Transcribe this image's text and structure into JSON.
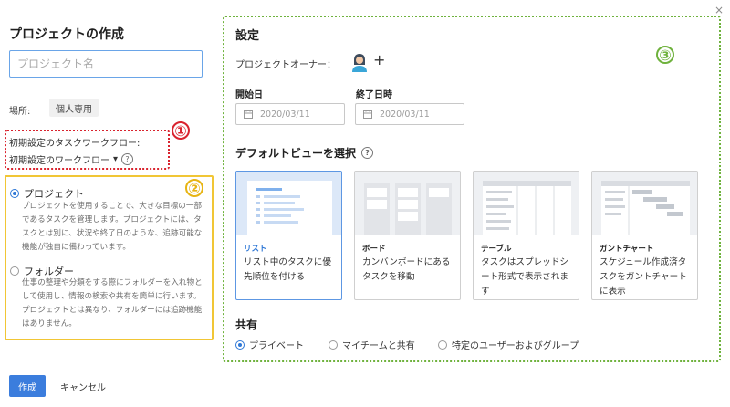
{
  "dialog": {
    "title": "プロジェクトの作成",
    "name_placeholder": "プロジェクト名",
    "location_label": "場所:",
    "location_value": "個人専用",
    "workflow_label": "初期設定のタスクワークフロー:",
    "workflow_select": "初期設定のワークフロー",
    "workflow_caret": "▾",
    "help_glyph": "?",
    "types": [
      {
        "title": "プロジェクト",
        "checked": true,
        "desc": "プロジェクトを使用することで、大きな目標の一部であるタスクを管理します。プロジェクトには、タスクとは別に、状況や終了日のような、追跡可能な機能が独自に備わっています。"
      },
      {
        "title": "フォルダー",
        "checked": false,
        "desc": "仕事の整理や分類をする際にフォルダーを入れ物として使用し、情報の検索や共有を簡単に行います。プロジェクトとは異なり、フォルダーには追跡機能はありません。"
      }
    ],
    "create_label": "作成",
    "cancel_label": "キャンセル",
    "close_glyph": "×"
  },
  "annotations": [
    "①",
    "②",
    "③"
  ],
  "settings": {
    "title": "設定",
    "owner_label": "プロジェクトオーナー：",
    "add_owner_glyph": "+",
    "start_label": "開始日",
    "end_label": "終了日時",
    "start_placeholder": "2020/03/11",
    "end_placeholder": "2020/03/11",
    "default_view_title": "デフォルトビューを選択",
    "views": [
      {
        "title": "リスト",
        "desc": "リスト中のタスクに優先順位を付ける",
        "selected": true
      },
      {
        "title": "ボード",
        "desc": "カンバンボードにあるタスクを移動",
        "selected": false
      },
      {
        "title": "テーブル",
        "desc": "タスクはスプレッドシート形式で表示されます",
        "selected": false
      },
      {
        "title": "ガントチャート",
        "desc": "スケジュール作成済タスクをガントチャートに表示",
        "selected": false
      }
    ],
    "share_title": "共有",
    "share_options": [
      {
        "label": "プライベート",
        "checked": true
      },
      {
        "label": "マイチームと共有",
        "checked": false
      },
      {
        "label": "特定のユーザーおよびグループ",
        "checked": false
      }
    ]
  },
  "colors": {
    "accent": "#3b7ddd",
    "annotation_red": "#d9232e",
    "annotation_yellow": "#f1c635",
    "annotation_green": "#6fb23d"
  },
  "icons": {
    "owner_avatar": "user-avatar-icon",
    "calendar": "calendar-icon",
    "help": "help-circle-icon",
    "close": "close-icon"
  }
}
